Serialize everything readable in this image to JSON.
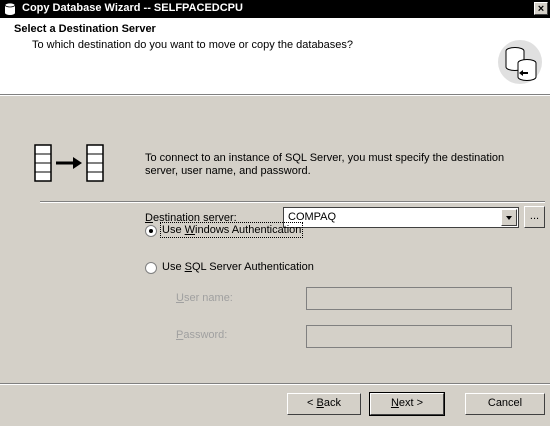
{
  "window": {
    "title": "Copy Database Wizard -- SELFPACEDCPU",
    "close_glyph": "×"
  },
  "header": {
    "title": "Select a Destination Server",
    "subtitle": "To which destination do you want to move or copy the databases?"
  },
  "info": {
    "text": "To connect to an instance of SQL Server, you must specify the destination server, user name, and password."
  },
  "destination": {
    "label_hotkey": "D",
    "label_rest": "estination server:",
    "value": "COMPAQ",
    "browse_label": "..."
  },
  "auth": {
    "windows": {
      "pre": "Use ",
      "hotkey": "W",
      "post": "indows Authentication",
      "selected": true
    },
    "sql": {
      "pre": "Use ",
      "hotkey": "S",
      "post": "QL Server Authentication",
      "selected": false
    }
  },
  "credentials": {
    "username": {
      "hotkey": "U",
      "rest": "ser name:",
      "value": ""
    },
    "password": {
      "hotkey": "P",
      "rest": "assword:",
      "value": ""
    }
  },
  "buttons": {
    "back": {
      "pre": "< ",
      "hotkey": "B",
      "post": "ack"
    },
    "next": {
      "pre": "",
      "hotkey": "N",
      "post": "ext >"
    },
    "cancel": "Cancel"
  }
}
